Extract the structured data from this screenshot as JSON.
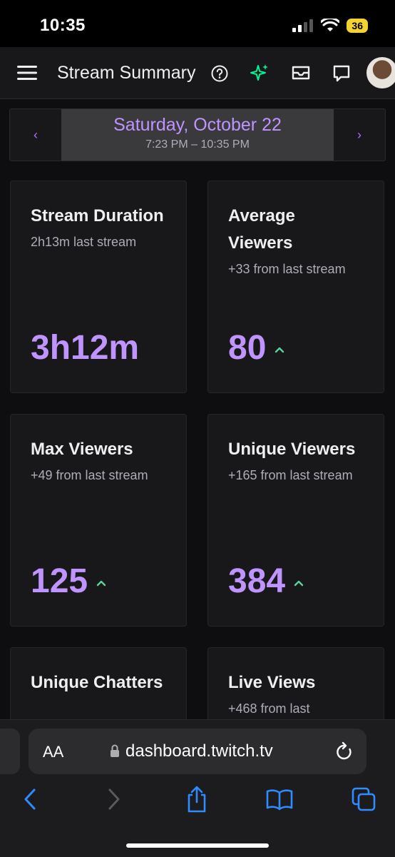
{
  "status_bar": {
    "time": "10:35",
    "battery": "36"
  },
  "header": {
    "title": "Stream Summary"
  },
  "date_nav": {
    "date": "Saturday, October 22",
    "range": "7:23 PM – 10:35 PM",
    "prev": "‹",
    "next": "›"
  },
  "cards": [
    {
      "label": "Stream Duration",
      "sub": "2h13m last stream",
      "value": "3h12m",
      "trend": ""
    },
    {
      "label": "Average Viewers",
      "sub": "+33 from last stream",
      "value": "80",
      "trend": "up"
    },
    {
      "label": "Max Viewers",
      "sub": "+49 from last stream",
      "value": "125",
      "trend": "up"
    },
    {
      "label": "Unique Viewers",
      "sub": "+165 from last stream",
      "value": "384",
      "trend": "up"
    },
    {
      "label": "Unique Chatters",
      "sub": "",
      "value": "",
      "trend": ""
    },
    {
      "label": "Live Views",
      "sub": "+468 from last",
      "value": "",
      "trend": ""
    }
  ],
  "browser": {
    "aa_label": "AA",
    "url": "dashboard.twitch.tv"
  },
  "colors": {
    "accent": "#bf94ff",
    "trend_up": "#5cd39a",
    "sparkle": "#00f593",
    "ios_blue": "#2f8cff"
  }
}
